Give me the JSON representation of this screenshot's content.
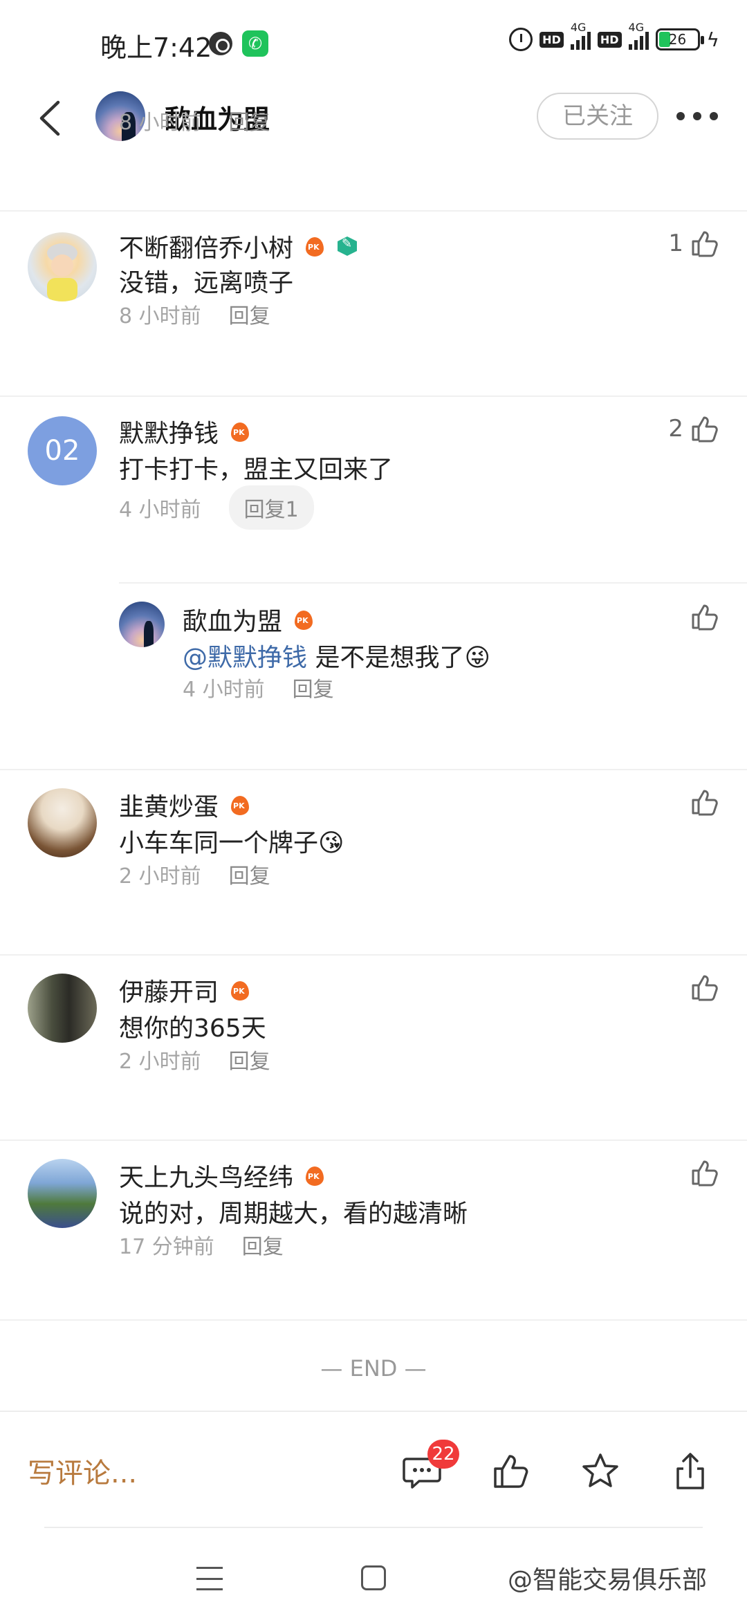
{
  "status_bar": {
    "time": "晚上7:42",
    "hd": "HD",
    "net": "4G",
    "battery": "26"
  },
  "header": {
    "title": "歃血为盟",
    "follow_label": "已关注"
  },
  "top_partial": {
    "time": "8 小时前",
    "reply_label": "回复"
  },
  "comments": [
    {
      "author": "不断翻倍乔小树",
      "text": "没错，远离喷子",
      "time": "8 小时前",
      "reply_label": "回复",
      "likes": "1"
    },
    {
      "author": "默默挣钱",
      "avatar_text": "02",
      "text": "打卡打卡，盟主又回来了",
      "time": "4 小时前",
      "reply_label": "回复1",
      "likes": "2",
      "reply": {
        "author": "歃血为盟",
        "mention": "@默默挣钱",
        "text": " 是不是想我了😜",
        "time": "4 小时前",
        "reply_label": "回复"
      }
    },
    {
      "author": "韭黄炒蛋",
      "text": "小车车同一个牌子😘",
      "time": "2 小时前",
      "reply_label": "回复"
    },
    {
      "author": "伊藤开司",
      "text": "想你的365天",
      "time": "2 小时前",
      "reply_label": "回复"
    },
    {
      "author": "天上九头鸟经纬",
      "text": "说的对，周期越大，看的越清晰",
      "time": "17 分钟前",
      "reply_label": "回复"
    }
  ],
  "end_label": "— END —",
  "action_bar": {
    "input_placeholder": "写评论...",
    "comment_count": "22"
  },
  "watermark": "@智能交易俱乐部",
  "colors": {
    "accent_input": "#b87a3e",
    "badge_red": "#f03a3a",
    "mention_blue": "#3e6aa8",
    "pk_orange": "#f26b21"
  }
}
